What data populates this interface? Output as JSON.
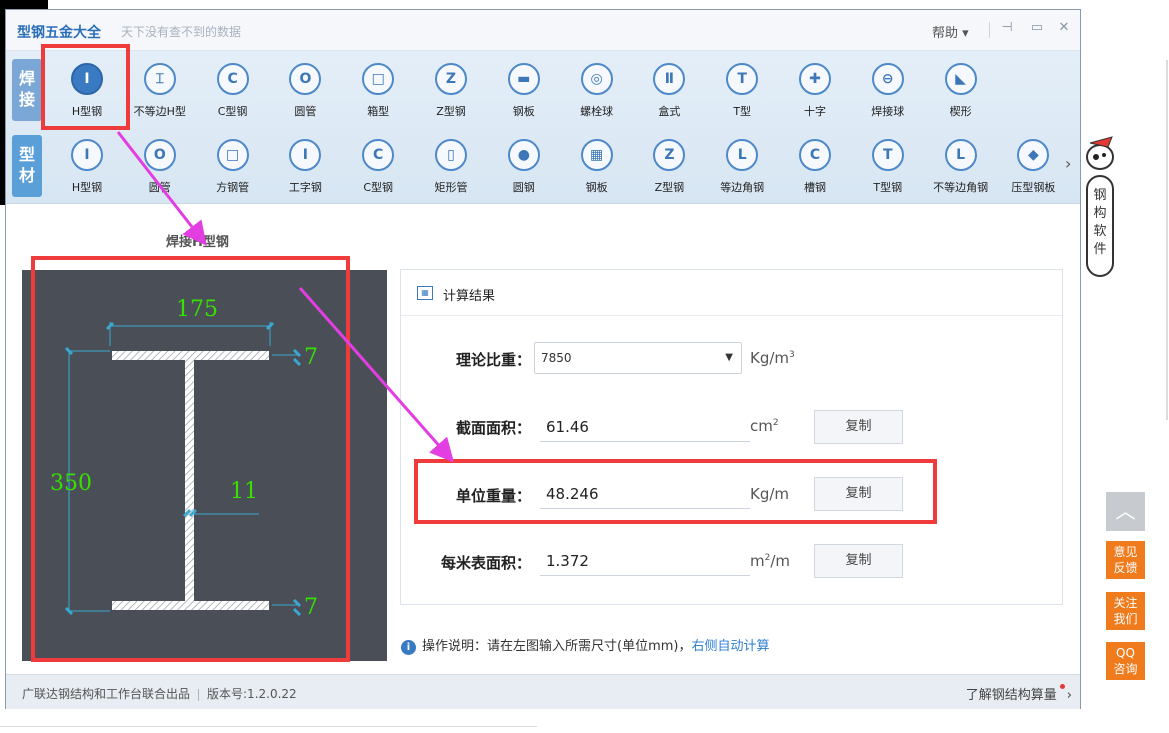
{
  "app": {
    "title": "型钢五金大全",
    "subtitle": "天下没有查不到的数据",
    "help_label": "帮助 ▾"
  },
  "side_tabs": {
    "weld": "焊接",
    "profile": "型材"
  },
  "toolbar": {
    "row1": [
      {
        "label": "H型钢",
        "glyph": "I"
      },
      {
        "label": "不等边H型",
        "glyph": "⌶"
      },
      {
        "label": "C型钢",
        "glyph": "C"
      },
      {
        "label": "圆管",
        "glyph": "O"
      },
      {
        "label": "箱型",
        "glyph": "□"
      },
      {
        "label": "Z型钢",
        "glyph": "Z"
      },
      {
        "label": "钢板",
        "glyph": "▬"
      },
      {
        "label": "螺栓球",
        "glyph": "◎"
      },
      {
        "label": "盒式",
        "glyph": "Ⅱ"
      },
      {
        "label": "T型",
        "glyph": "T"
      },
      {
        "label": "十字",
        "glyph": "✚"
      },
      {
        "label": "焊接球",
        "glyph": "⊖"
      },
      {
        "label": "楔形",
        "glyph": "◣"
      }
    ],
    "row2": [
      {
        "label": "H型钢",
        "glyph": "I"
      },
      {
        "label": "圆管",
        "glyph": "O"
      },
      {
        "label": "方钢管",
        "glyph": "□"
      },
      {
        "label": "工字钢",
        "glyph": "I"
      },
      {
        "label": "C型钢",
        "glyph": "C"
      },
      {
        "label": "矩形管",
        "glyph": "▯"
      },
      {
        "label": "圆钢",
        "glyph": "●"
      },
      {
        "label": "钢板",
        "glyph": "▦"
      },
      {
        "label": "Z型钢",
        "glyph": "Z"
      },
      {
        "label": "等边角钢",
        "glyph": "L"
      },
      {
        "label": "槽钢",
        "glyph": "Ⅽ"
      },
      {
        "label": "T型钢",
        "glyph": "T"
      },
      {
        "label": "不等边角钢",
        "glyph": "L"
      },
      {
        "label": "压型钢板",
        "glyph": "◆"
      }
    ]
  },
  "drawing": {
    "title": "焊接H型钢",
    "dim_width": "175",
    "dim_height": "350",
    "dim_web": "11",
    "dim_flange_top": "7",
    "dim_flange_bottom": "7"
  },
  "results": {
    "header": "计算结果",
    "density_label": "理论比重：",
    "density_value": "7850",
    "density_unit_base": "Kg/m",
    "density_unit_sup": "3",
    "area_label": "截面面积：",
    "area_value": "61.46",
    "area_unit_base": "cm",
    "area_unit_sup": "2",
    "weight_label": "单位重量：",
    "weight_value": "48.246",
    "weight_unit": "Kg/m",
    "surface_label": "每米表面积：",
    "surface_value": "1.372",
    "surface_unit_base": "m",
    "surface_unit_sup": "2",
    "surface_unit_tail": "/m",
    "copy_label": "复制"
  },
  "note": {
    "text": "操作说明：请在左图输入所需尺寸(单位mm)，",
    "link": "右侧自动计算"
  },
  "status": {
    "credit": "广联达钢结构和工作台联合出品",
    "version": "版本号:1.2.0.22",
    "learn_more": "了解钢结构算量"
  },
  "mascot_text": "钢构软件",
  "side_buttons": {
    "feedback": "意见反馈",
    "follow": "关注我们",
    "qq": "QQ咨询"
  },
  "colors": {
    "brand_blue": "#3a7ac2",
    "highlight_red": "#ef3b3b",
    "arrow_magenta": "#e23ee2",
    "dimension_green": "#36e000",
    "side_orange": "#f07b1d"
  }
}
